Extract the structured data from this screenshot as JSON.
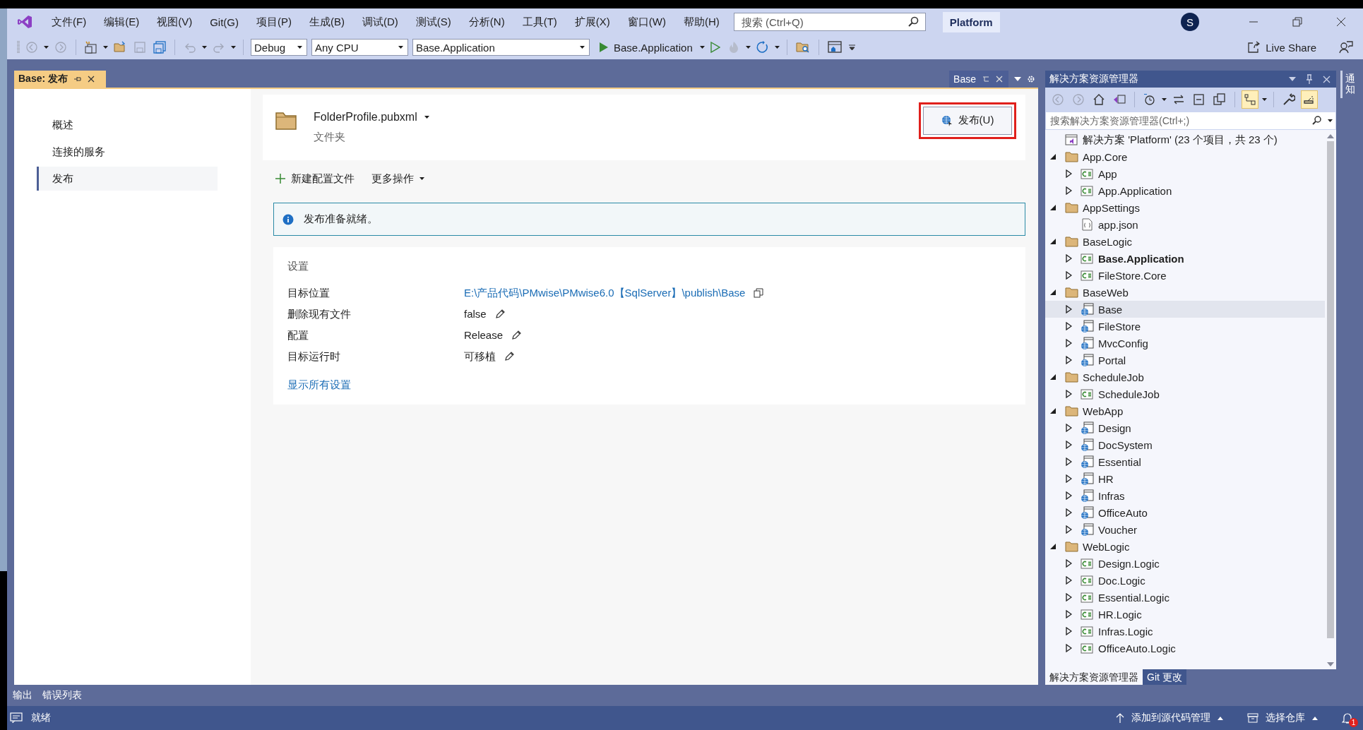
{
  "menu": [
    "文件(F)",
    "编辑(E)",
    "视图(V)",
    "Git(G)",
    "项目(P)",
    "生成(B)",
    "调试(D)",
    "测试(S)",
    "分析(N)",
    "工具(T)",
    "扩展(X)",
    "窗口(W)",
    "帮助(H)"
  ],
  "search": {
    "placeholder": "搜索 (Ctrl+Q)"
  },
  "solution_name": "Platform",
  "account": {
    "initial": "S"
  },
  "toolbar": {
    "configuration": "Debug",
    "platform": "Any CPU",
    "startup_project": "Base.Application",
    "run_target": "Base.Application",
    "live_share": "Live Share"
  },
  "document_tabs": [
    {
      "label": "Base: 发布",
      "selected": true
    },
    {
      "label": "Base",
      "selected": false
    }
  ],
  "publish_nav": [
    {
      "label": "概述",
      "selected": false
    },
    {
      "label": "连接的服务",
      "selected": false
    },
    {
      "label": "发布",
      "selected": true
    }
  ],
  "profile": {
    "name": "FolderProfile.pubxml",
    "type": "文件夹",
    "publish_button": {
      "label": "发布(U)",
      "highlighted": true
    }
  },
  "actions": [
    {
      "label": "新建配置文件",
      "kind": "add"
    },
    {
      "label": "更多操作",
      "kind": "menu"
    }
  ],
  "info": "发布准备就绪。",
  "settings": {
    "title": "设置",
    "rows": [
      {
        "label": "目标位置",
        "value": "E:\\产品代码\\PMwise\\PMwise6.0【SqlServer】\\publish\\Base",
        "kind": "path"
      },
      {
        "label": "删除现有文件",
        "value": "false",
        "kind": "editable"
      },
      {
        "label": "配置",
        "value": "Release",
        "kind": "editable"
      },
      {
        "label": "目标运行时",
        "value": "可移植",
        "kind": "editable"
      }
    ],
    "show_all": "显示所有设置"
  },
  "solution_explorer": {
    "title": "解决方案资源管理器",
    "tools": [
      {
        "kind": "back",
        "pressed": false
      },
      {
        "kind": "forward",
        "pressed": false
      },
      {
        "kind": "home",
        "pressed": false
      },
      {
        "kind": "switch",
        "pressed": false
      },
      {
        "kind": "history",
        "pressed": false
      },
      {
        "kind": "sync",
        "pressed": false
      },
      {
        "kind": "collapse",
        "pressed": false
      },
      {
        "kind": "copy",
        "pressed": false
      },
      {
        "kind": "tree",
        "pressed": true
      },
      {
        "kind": "wrench",
        "pressed": false
      },
      {
        "kind": "preview",
        "pressed": true
      }
    ],
    "search": {
      "placeholder": "搜索解决方案资源管理器(Ctrl+;)"
    },
    "tree": [
      {
        "label": "解决方案 'Platform' (23 个项目，共 23 个)",
        "kind": "solution",
        "selected": false,
        "children": [
          {
            "label": "App.Core",
            "kind": "folder",
            "expanded": true,
            "selected": false,
            "children": [
              {
                "label": "App",
                "kind": "csharp",
                "expanded": false,
                "selected": false,
                "startup": false
              },
              {
                "label": "App.Application",
                "kind": "csharp",
                "expanded": false,
                "selected": false,
                "startup": false
              }
            ]
          },
          {
            "label": "AppSettings",
            "kind": "folder",
            "expanded": true,
            "selected": false,
            "children": [
              {
                "label": "app.json",
                "kind": "json",
                "selected": false,
                "startup": false
              }
            ]
          },
          {
            "label": "BaseLogic",
            "kind": "folder",
            "expanded": true,
            "selected": false,
            "children": [
              {
                "label": "Base.Application",
                "kind": "csharp",
                "expanded": false,
                "selected": false,
                "startup": true
              },
              {
                "label": "FileStore.Core",
                "kind": "csharp",
                "expanded": false,
                "selected": false,
                "startup": false
              }
            ]
          },
          {
            "label": "BaseWeb",
            "kind": "folder",
            "expanded": true,
            "selected": false,
            "children": [
              {
                "label": "Base",
                "kind": "web",
                "expanded": false,
                "selected": true,
                "startup": false
              },
              {
                "label": "FileStore",
                "kind": "web",
                "expanded": false,
                "selected": false,
                "startup": false
              },
              {
                "label": "MvcConfig",
                "kind": "web",
                "expanded": false,
                "selected": false,
                "startup": false
              },
              {
                "label": "Portal",
                "kind": "web",
                "expanded": false,
                "selected": false,
                "startup": false
              }
            ]
          },
          {
            "label": "ScheduleJob",
            "kind": "folder",
            "expanded": true,
            "selected": false,
            "children": [
              {
                "label": "ScheduleJob",
                "kind": "csharp",
                "expanded": false,
                "selected": false,
                "startup": false
              }
            ]
          },
          {
            "label": "WebApp",
            "kind": "folder",
            "expanded": true,
            "selected": false,
            "children": [
              {
                "label": "Design",
                "kind": "web",
                "expanded": false,
                "selected": false,
                "startup": false
              },
              {
                "label": "DocSystem",
                "kind": "web",
                "expanded": false,
                "selected": false,
                "startup": false
              },
              {
                "label": "Essential",
                "kind": "web",
                "expanded": false,
                "selected": false,
                "startup": false
              },
              {
                "label": "HR",
                "kind": "web",
                "expanded": false,
                "selected": false,
                "startup": false
              },
              {
                "label": "Infras",
                "kind": "web",
                "expanded": false,
                "selected": false,
                "startup": false
              },
              {
                "label": "OfficeAuto",
                "kind": "web",
                "expanded": false,
                "selected": false,
                "startup": false
              },
              {
                "label": "Voucher",
                "kind": "web",
                "expanded": false,
                "selected": false,
                "startup": false
              }
            ]
          },
          {
            "label": "WebLogic",
            "kind": "folder",
            "expanded": true,
            "selected": false,
            "children": [
              {
                "label": "Design.Logic",
                "kind": "csharp",
                "expanded": false,
                "selected": false,
                "startup": false
              },
              {
                "label": "Doc.Logic",
                "kind": "csharp",
                "expanded": false,
                "selected": false,
                "startup": false
              },
              {
                "label": "Essential.Logic",
                "kind": "csharp",
                "expanded": false,
                "selected": false,
                "startup": false
              },
              {
                "label": "HR.Logic",
                "kind": "csharp",
                "expanded": false,
                "selected": false,
                "startup": false
              },
              {
                "label": "Infras.Logic",
                "kind": "csharp",
                "expanded": false,
                "selected": false,
                "startup": false
              },
              {
                "label": "OfficeAuto.Logic",
                "kind": "csharp",
                "expanded": false,
                "selected": false,
                "startup": false
              }
            ]
          }
        ]
      }
    ],
    "bottom_tabs": [
      {
        "label": "解决方案资源管理器",
        "selected": true
      },
      {
        "label": "Git 更改",
        "selected": false
      }
    ]
  },
  "side_tab": "通知",
  "panel_tabs": [
    "输出",
    "错误列表"
  ],
  "status_bar": {
    "text": "就绪",
    "source_control": "添加到源代码管理",
    "repository": "选择仓库",
    "notifications": "1"
  }
}
